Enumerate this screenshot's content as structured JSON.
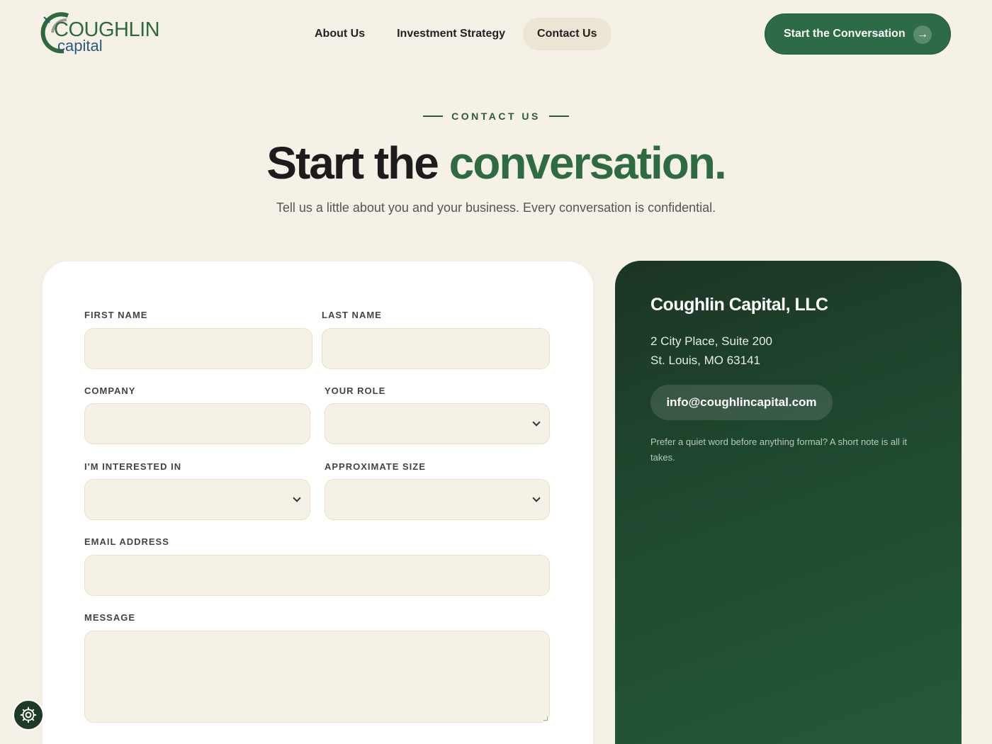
{
  "logo": {
    "word": "COUGHLIN",
    "sub": "capital"
  },
  "nav": {
    "items": [
      {
        "label": "About Us",
        "active": false
      },
      {
        "label": "Investment Strategy",
        "active": false
      },
      {
        "label": "Contact Us",
        "active": true
      }
    ],
    "cta_label": "Start the Conversation",
    "cta_icon": "arrow-right-icon"
  },
  "hero": {
    "eyebrow": "CONTACT US",
    "title_dark": "Start the",
    "title_accent": "conversation.",
    "subtitle": "Tell us a little about you and your business. Every conversation is confidential."
  },
  "form": {
    "first_name_label": "FIRST NAME",
    "last_name_label": "LAST NAME",
    "company_label": "COMPANY",
    "role_label": "YOUR ROLE",
    "interest_label": "I'M INTERESTED IN",
    "size_label": "APPROXIMATE SIZE",
    "email_label": "EMAIL ADDRESS",
    "message_label": "MESSAGE"
  },
  "info": {
    "company": "Coughlin Capital, LLC",
    "address_line1": "2 City Place, Suite 200",
    "address_line2": "St. Louis, MO 63141",
    "email": "info@coughlincapital.com",
    "note": "Prefer a quiet word before anything formal? A short note is all it takes."
  },
  "colors": {
    "brand_green": "#2d6a47",
    "background": "#f6f1e7",
    "dark_green": "#1c3524"
  }
}
